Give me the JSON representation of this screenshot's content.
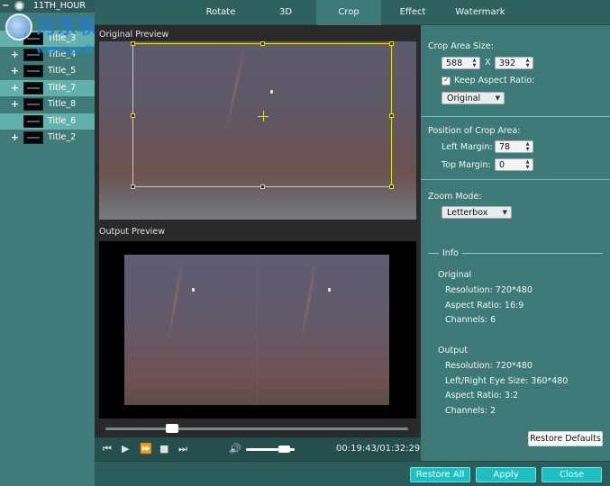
{
  "title_list": {
    "disc_label": "11TH_HOUR",
    "items": [
      {
        "label": "Title_3",
        "expand": "",
        "selected": true
      },
      {
        "label": "Title_4",
        "expand": "+",
        "selected": false
      },
      {
        "label": "Title_5",
        "expand": "+",
        "selected": false
      },
      {
        "label": "Title_7",
        "expand": "+",
        "selected": true
      },
      {
        "label": "Title_8",
        "expand": "+",
        "selected": false
      },
      {
        "label": "Title_6",
        "expand": "",
        "selected": true
      },
      {
        "label": "Title_2",
        "expand": "+",
        "selected": false
      }
    ]
  },
  "watermark": {
    "text": "河东软件园",
    "url": "www.pc0359.cn"
  },
  "tabs": [
    {
      "label": "Rotate",
      "active": false
    },
    {
      "label": "3D",
      "active": false
    },
    {
      "label": "Crop",
      "active": true
    },
    {
      "label": "Effect",
      "active": false
    },
    {
      "label": "Watermark",
      "active": false
    }
  ],
  "preview": {
    "original_label": "Original Preview",
    "output_label": "Output Preview",
    "seek_fraction": 0.22,
    "volume_fraction": 0.78,
    "timecode": "00:19:43/01:32:29"
  },
  "crop": {
    "area_size_label": "Crop Area Size:",
    "width": "588",
    "x_sep": "X",
    "height": "392",
    "keep_aspect_label": "Keep Aspect Ratio:",
    "keep_aspect_checked": true,
    "aspect_option": "Original",
    "position_label": "Position of Crop Area:",
    "left_margin_label": "Left Margin:",
    "left_margin": "78",
    "top_margin_label": "Top Margin:",
    "top_margin": "0",
    "zoom_label": "Zoom Mode:",
    "zoom_option": "Letterbox"
  },
  "info": {
    "title": "Info",
    "original_heading": "Original",
    "original_resolution": "Resolution: 720*480",
    "original_aspect": "Aspect Ratio: 16:9",
    "original_channels": "Channels: 6",
    "output_heading": "Output",
    "output_resolution": "Resolution: 720*480",
    "output_eye_size": "Left/Right Eye Size: 360*480",
    "output_aspect": "Aspect Ratio: 3:2",
    "output_channels": "Channels: 2"
  },
  "buttons": {
    "restore_defaults": "Restore Defaults",
    "restore_all": "Restore All",
    "apply": "Apply",
    "close": "Close"
  },
  "colors": {
    "accent_button": "#1dbfc0",
    "crop_frame": "#e6e000",
    "panel": "#3d7a77"
  }
}
